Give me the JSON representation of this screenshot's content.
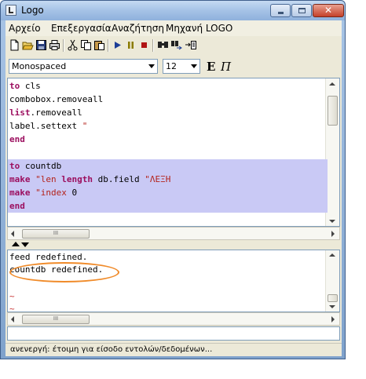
{
  "window": {
    "title": "Logo",
    "close_glyph": "✕"
  },
  "menubar": {
    "items": [
      "Αρχείο",
      "Επεξεργασία",
      "Αναζήτηση",
      "Μηχανή LOGO"
    ]
  },
  "toolbar": {
    "icons": [
      "new-file-icon",
      "open-folder-icon",
      "save-icon",
      "print-icon",
      "cut-icon",
      "copy-icon",
      "paste-icon",
      "run-icon",
      "pause-icon",
      "stop-icon",
      "find-icon",
      "replace-icon",
      "goto-line-icon"
    ]
  },
  "fontbar": {
    "font_value": "Monospaced",
    "size_value": "12",
    "bold_label": "E",
    "italic_label": "Π"
  },
  "editor": {
    "lines": [
      {
        "parts": [
          {
            "t": "to",
            "c": "kw"
          },
          {
            "t": " cls",
            "c": ""
          }
        ],
        "sel": false
      },
      {
        "parts": [
          {
            "t": "combobox.removeall",
            "c": ""
          }
        ],
        "sel": false
      },
      {
        "parts": [
          {
            "t": "list",
            "c": "kw"
          },
          {
            "t": ".removeall",
            "c": ""
          }
        ],
        "sel": false
      },
      {
        "parts": [
          {
            "t": "label.settext ",
            "c": ""
          },
          {
            "t": "\"",
            "c": "str"
          }
        ],
        "sel": false
      },
      {
        "parts": [
          {
            "t": "end",
            "c": "kw"
          }
        ],
        "sel": false
      },
      {
        "parts": [
          {
            "t": "",
            "c": ""
          }
        ],
        "sel": false
      },
      {
        "parts": [
          {
            "t": "to",
            "c": "kw"
          },
          {
            "t": " countdb",
            "c": ""
          }
        ],
        "sel": true
      },
      {
        "parts": [
          {
            "t": "make",
            "c": "kw"
          },
          {
            "t": " ",
            "c": ""
          },
          {
            "t": "\"len",
            "c": "str"
          },
          {
            "t": " ",
            "c": ""
          },
          {
            "t": "length",
            "c": "kw"
          },
          {
            "t": " db.field ",
            "c": ""
          },
          {
            "t": "\"ΛΕΞΗ",
            "c": "str"
          }
        ],
        "sel": true
      },
      {
        "parts": [
          {
            "t": "make",
            "c": "kw"
          },
          {
            "t": " ",
            "c": ""
          },
          {
            "t": "\"index",
            "c": "str"
          },
          {
            "t": " 0",
            "c": ""
          }
        ],
        "sel": true
      },
      {
        "parts": [
          {
            "t": "end",
            "c": "kw"
          }
        ],
        "sel": true
      }
    ]
  },
  "output": {
    "lines": [
      "feed redefined.",
      "countdb redefined."
    ],
    "tildes": [
      "~",
      "~"
    ]
  },
  "scrollbar": {
    "grip": "III"
  },
  "status": {
    "text": "ανενεργή: έτοιμη για είσοδο εντολών/δεδομένων..."
  },
  "colors": {
    "keyword": "#9c0f5f",
    "string": "#b4221a",
    "selection": "#c9c9f5",
    "annotation": "#f08b2a"
  }
}
